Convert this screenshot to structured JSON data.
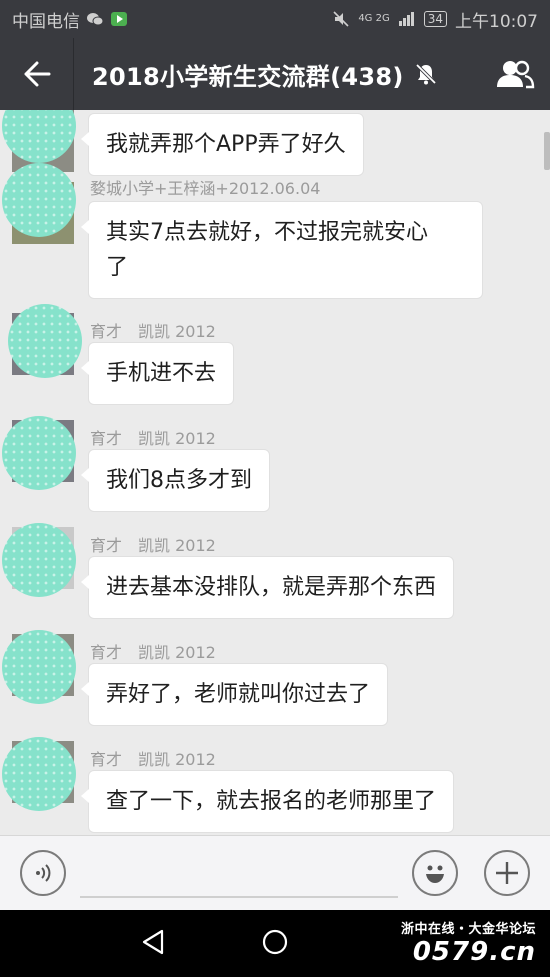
{
  "status_bar": {
    "carrier": "中国电信",
    "network": "4G 2G",
    "battery": "34",
    "time": "上午10:07"
  },
  "header": {
    "title": "2018小学新生交流群(438)",
    "back_icon": "arrow-left-icon",
    "mute_icon": "bell-off-icon",
    "contacts_icon": "group-icon"
  },
  "messages": [
    {
      "sender": "",
      "lines": [
        "我就弄那个APP弄了好久"
      ]
    },
    {
      "sender": "婺城小学+王梓涵+2012.06.04",
      "lines": [
        "其实7点去就好，不过报完就安心",
        "了"
      ]
    },
    {
      "sender": "育才　凯凯 2012",
      "lines": [
        "手机进不去"
      ]
    },
    {
      "sender": "育才　凯凯 2012",
      "lines": [
        "我们8点多才到"
      ]
    },
    {
      "sender": "育才　凯凯 2012",
      "lines": [
        "进去基本没排队，就是弄那个东西"
      ]
    },
    {
      "sender": "育才　凯凯 2012",
      "lines": [
        "弄好了，老师就叫你过去了"
      ]
    },
    {
      "sender": "育才　凯凯 2012",
      "lines": [
        "查了一下，就去报名的老师那里了"
      ]
    }
  ],
  "input_bar": {
    "voice_icon": "voice-icon",
    "emoji_icon": "emoji-icon",
    "more_icon": "plus-icon"
  },
  "watermark": {
    "line1": "浙中在线・大金华论坛",
    "line2": "0579.cn"
  },
  "colors": {
    "header_bg": "#393a3f",
    "chat_bg": "#ebebeb",
    "avatar": "#86e2cb"
  }
}
